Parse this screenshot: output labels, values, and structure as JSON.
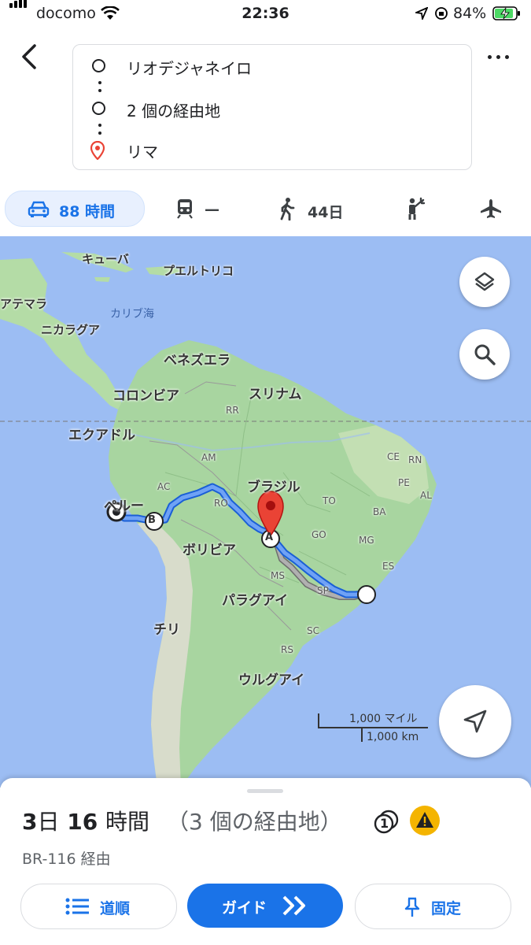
{
  "status": {
    "carrier": "docomo",
    "time": "22:36",
    "battery": "84%"
  },
  "route": {
    "origin": "リオデジャネイロ",
    "waypoints": "2 個の経由地",
    "destination": "リマ"
  },
  "modes": [
    {
      "name": "drive",
      "label": "88 時間",
      "selected": true
    },
    {
      "name": "transit",
      "label": "—"
    },
    {
      "name": "walk",
      "label": "44日"
    },
    {
      "name": "ride",
      "label": ""
    },
    {
      "name": "flight",
      "label": ""
    }
  ],
  "map": {
    "labels": {
      "cuba": "キューバ",
      "puertorico": "プエルトリコ",
      "guatemala": "アテマラ",
      "caribbean": "カリブ海",
      "nicaragua": "ニカラグア",
      "venezuela": "ベネズエラ",
      "colombia": "コロンビア",
      "suriname": "スリナム",
      "ecuador": "エクアドル",
      "rr": "RR",
      "am": "AM",
      "ce": "CE",
      "rn": "RN",
      "pe": "PE",
      "al": "AL",
      "ac": "AC",
      "brazil": "ブラジル",
      "ro": "RO",
      "to": "TO",
      "ba": "BA",
      "peru": "ペルー",
      "bolivia": "ボリビア",
      "go": "GO",
      "mg": "MG",
      "es": "ES",
      "ms": "MS",
      "sp": "SP",
      "paraguay": "パラグアイ",
      "chile": "チリ",
      "sc": "SC",
      "rs": "RS",
      "uruguay": "ウルグアイ"
    },
    "marker_a": "A",
    "marker_b": "B",
    "scale_miles": "1,000 マイル",
    "scale_km": "1,000 km"
  },
  "summary": {
    "duration_day_num": "3",
    "duration_day_unit": "日",
    "duration_hour_num": "16",
    "duration_hour_unit": "時間",
    "waypoints_note": "（3 個の経由地）",
    "toll_badge": "1",
    "via": "BR-116 経由"
  },
  "buttons": {
    "steps": "道順",
    "guide": "ガイド",
    "pin": "固定"
  },
  "colors": {
    "accent": "#1a73e8",
    "route": "#4285f4",
    "alt_route": "#9aa0a6",
    "land": "#a8d5a0",
    "water": "#9cbdf3",
    "pin": "#ea4335",
    "warning": "#f4b400"
  }
}
